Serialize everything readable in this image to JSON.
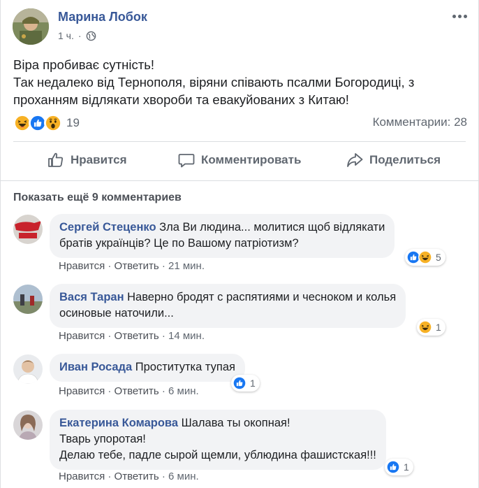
{
  "post": {
    "author": "Марина Лобок",
    "time": "1 ч.",
    "separator": "·",
    "text_lines": [
      "Віра пробиває сутність!",
      "Так недалеко від Тернополя, віряни співають псалми Богородиці, з",
      "проханням відлякати хвороби та евакуйованих з Китаю!"
    ],
    "reactions_count": "19",
    "comments_count": "Комментарии: 28"
  },
  "actions": {
    "like": "Нравится",
    "comment": "Комментировать",
    "share": "Поделиться"
  },
  "show_more": "Показать ещё 9 комментариев",
  "comments": [
    {
      "name": "Сергей Стеценко",
      "lines": [
        " Зла Ви людина... молитися щоб відлякати",
        "братів українців? Це по Вашому патріотизм?"
      ],
      "like": "Нравится",
      "reply": "Ответить",
      "time": "21 мин.",
      "reactions": "5"
    },
    {
      "name": "Вася Таран",
      "lines": [
        " Наверно бродят с распятиями и чесноком и колья",
        "осиновые наточили..."
      ],
      "like": "Нравится",
      "reply": "Ответить",
      "time": "14 мин.",
      "reactions": "1"
    },
    {
      "name": "Иван Росада",
      "lines": [
        " Проститутка тупая"
      ],
      "like": "Нравится",
      "reply": "Ответить",
      "time": "6 мин.",
      "reactions": "1"
    },
    {
      "name": "Екатерина Комарова",
      "lines": [
        " Шалава ты окопная!",
        "Тварь упоротая!",
        "Делаю тебе, падле сырой щемли, ублюдина фашистская!!!"
      ],
      "like": "Нравится",
      "reply": "Ответить",
      "time": "6 мин.",
      "reactions": "1"
    }
  ],
  "dot": " · ",
  "colors": {
    "link": "#385898",
    "bubble": "#f2f3f5",
    "meta": "#606770",
    "like_blue": "#1877f2",
    "haha_yellow": "#f7b125"
  },
  "icons": [
    "globe-icon",
    "more-icon",
    "like-icon",
    "comment-icon",
    "share-icon",
    "haha-emoji",
    "like-emoji",
    "wow-emoji"
  ]
}
